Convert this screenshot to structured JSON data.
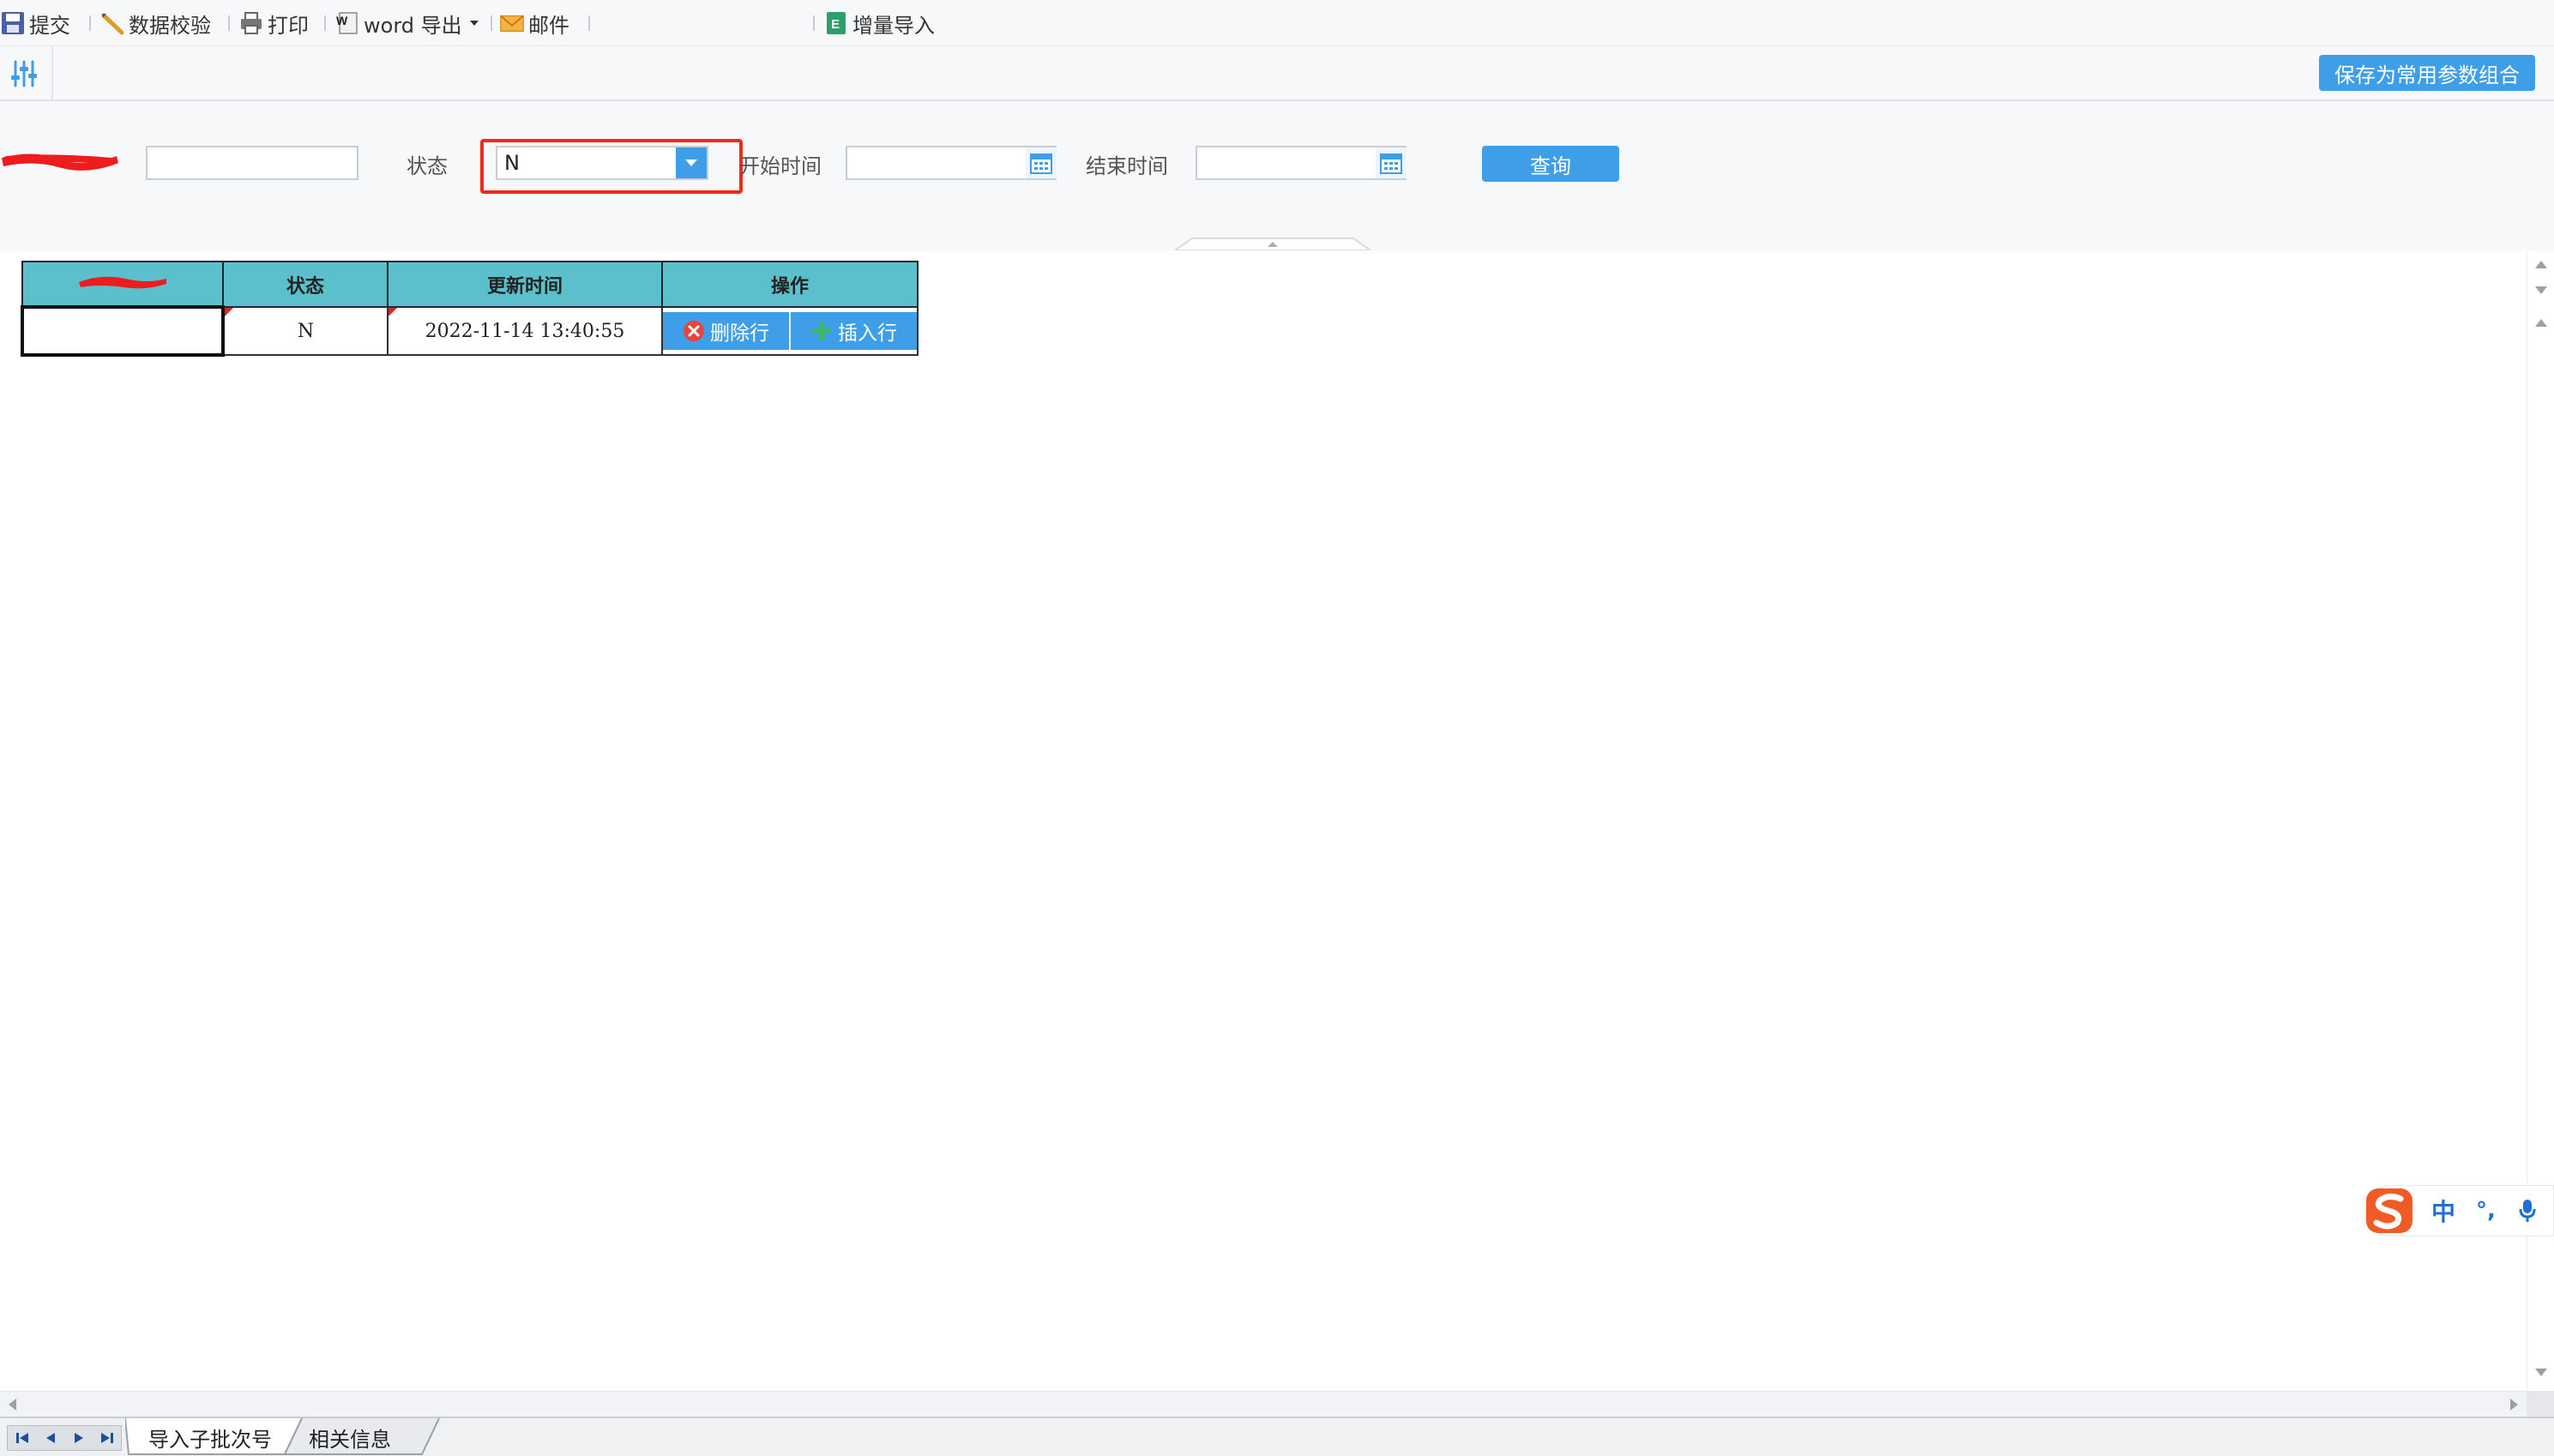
{
  "toolbar": {
    "submit_label": "提交",
    "validate_label": "数据校验",
    "print_label": "打印",
    "word_export_label": "word 导出",
    "mail_label": "邮件",
    "incremental_import_label": "增量导入"
  },
  "param_bar": {
    "save_combo_label": "保存为常用参数组合"
  },
  "query": {
    "field1_value": "",
    "status_label": "状态",
    "status_value": "N",
    "start_label": "开始时间",
    "start_value": "",
    "end_label": "结束时间",
    "end_value": "",
    "query_label": "查询"
  },
  "grid": {
    "headers": {
      "col2": "状态",
      "col3": "更新时间",
      "col4": "操作"
    },
    "rows": [
      {
        "col1": "",
        "status": "N",
        "updated": "2022-11-14 13:40:55"
      }
    ],
    "delete_row_label": "删除行",
    "insert_row_label": "插入行"
  },
  "sheets": {
    "tab1": "导入子批次号",
    "tab2": "相关信息"
  },
  "ime": {
    "mode": "中",
    "punct": "°,"
  },
  "colors": {
    "accent": "#3e9ee8",
    "header_bg": "#5bc0cc",
    "highlight": "#ee2a1f"
  }
}
